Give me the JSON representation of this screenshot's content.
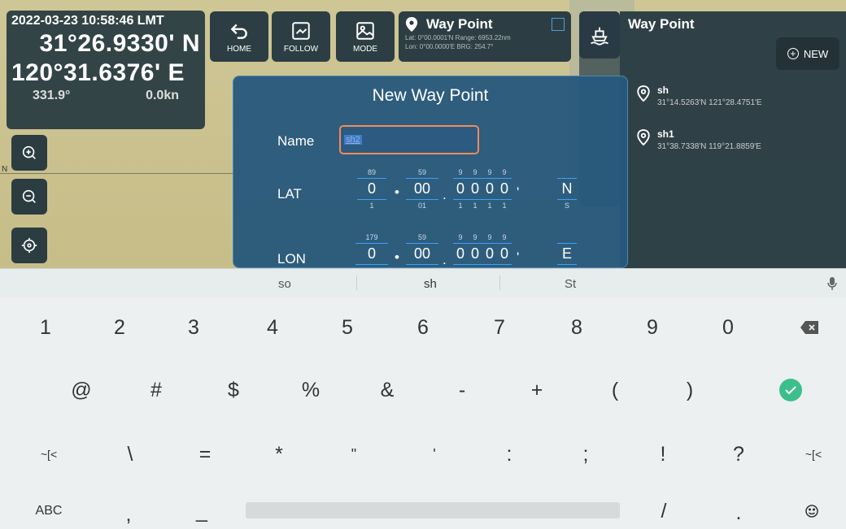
{
  "position": {
    "datetime": "2022-03-23 10:58:46 LMT",
    "lat": "31°26.9330' N",
    "lon": "120°31.6376' E",
    "heading": "331.9°",
    "speed": "0.0kn"
  },
  "map": {
    "edge_label": "N"
  },
  "toolbar": {
    "home_label": "HOME",
    "follow_label": "FOLLOW",
    "mode_label": "MODE"
  },
  "waypoint_card": {
    "title": "Way Point",
    "line1": "Lat: 0°00.0001'N  Range: 6953.22nm",
    "line2": "Lon: 0°00.0000'E  BRG: 254.7°"
  },
  "panel": {
    "title": "Way Point",
    "new_label": "NEW",
    "items": [
      {
        "name": "sh",
        "coords": "31°14.5263'N  121°28.4751'E"
      },
      {
        "name": "sh1",
        "coords": "31°38.7338'N  119°21.8859'E"
      }
    ]
  },
  "dialog": {
    "title": "New Way Point",
    "name_label": "Name",
    "name_value": "sh2",
    "lat_label": "LAT",
    "lon_label": "LON",
    "lat": {
      "deg": {
        "up": "89",
        "val": "0",
        "dn": "1"
      },
      "min": {
        "up": "59",
        "val": "00",
        "dn": "01"
      },
      "d1": {
        "up": "9",
        "val": "0",
        "dn": "1"
      },
      "d2": {
        "up": "9",
        "val": "0",
        "dn": "1"
      },
      "d3": {
        "up": "9",
        "val": "0",
        "dn": "1"
      },
      "d4": {
        "up": "9",
        "val": "0",
        "dn": "1"
      },
      "hemi": {
        "val": "N",
        "dn": "S"
      }
    },
    "lon": {
      "deg": {
        "up": "179",
        "val": "0"
      },
      "min": {
        "up": "59",
        "val": "00"
      },
      "d1": {
        "up": "9",
        "val": "0"
      },
      "d2": {
        "up": "9",
        "val": "0"
      },
      "d3": {
        "up": "9",
        "val": "0"
      },
      "d4": {
        "up": "9",
        "val": "0"
      },
      "hemi": {
        "val": "E"
      }
    }
  },
  "keyboard": {
    "suggestions": [
      "so",
      "sh",
      "St"
    ],
    "row1": [
      "1",
      "2",
      "3",
      "4",
      "5",
      "6",
      "7",
      "8",
      "9",
      "0"
    ],
    "row2": [
      "@",
      "#",
      "$",
      "%",
      "&",
      "-",
      "+",
      "(",
      ")"
    ],
    "row3": [
      "~[<",
      "\\",
      "=",
      "*",
      "\"",
      "'",
      ":",
      ";",
      "!",
      "?",
      "~[<"
    ],
    "row4": {
      "abc": "ABC",
      "comma": ",",
      "underscore": "_",
      "slash": "/",
      "period": "."
    }
  },
  "colors": {
    "accent": "#3aa0ff",
    "go": "#3cbf8c",
    "dialog": "#28587c"
  }
}
